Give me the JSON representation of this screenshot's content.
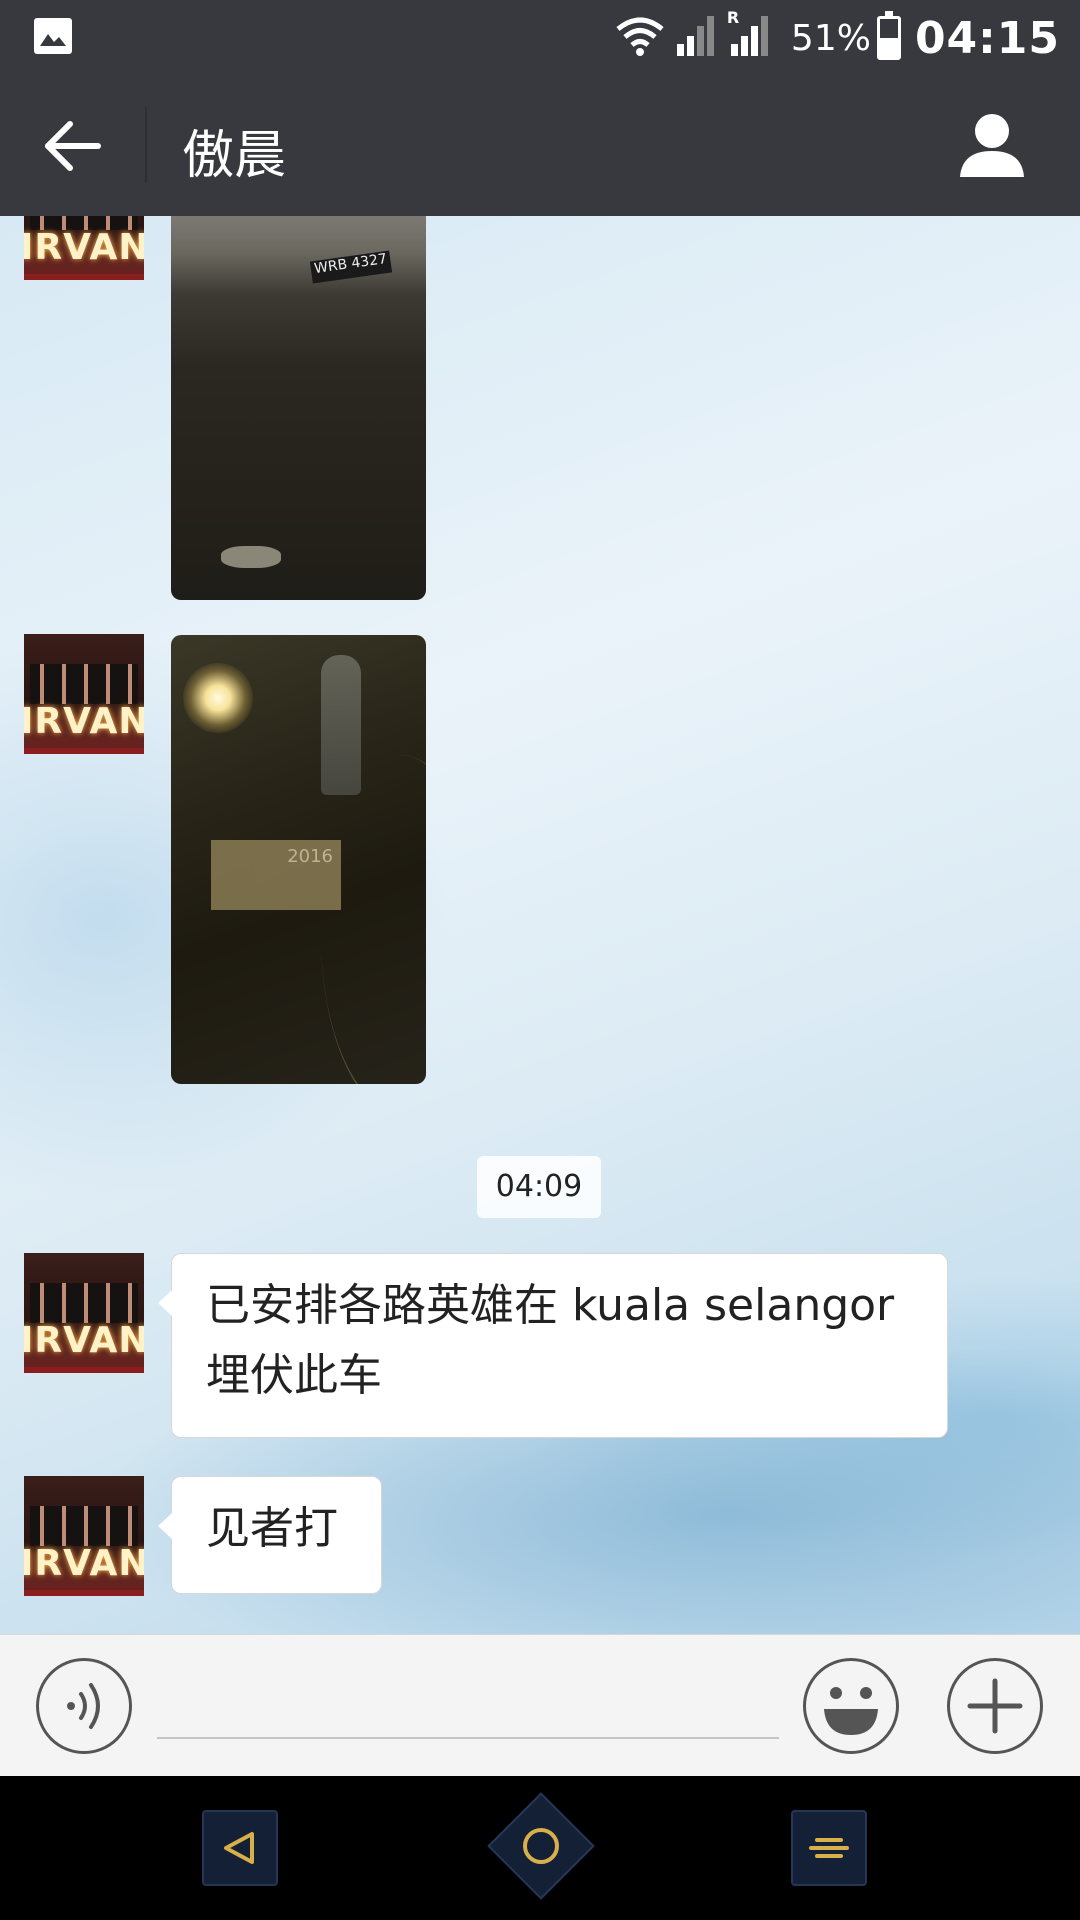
{
  "status_bar": {
    "battery_percent": "51%",
    "battery_level": 0.51,
    "time": "04:15",
    "roaming_indicator": "R",
    "icons": [
      "gallery-icon",
      "wifi-icon",
      "signal-icon",
      "signal-roaming-icon",
      "battery-icon"
    ]
  },
  "header": {
    "title": "傲晨",
    "back_icon": "arrow-left-icon",
    "profile_icon": "person-icon"
  },
  "chat": {
    "avatar_caption": "IRVANA",
    "photo_plate_text": "WRB 4327",
    "photo_sticker_text": "2016",
    "timestamp": "04:09",
    "messages": [
      {
        "type": "text",
        "text": "已安排各路英雄在 kuala selangor 埋伏此车"
      },
      {
        "type": "text",
        "text": "见者打"
      }
    ]
  },
  "input_bar": {
    "value": "",
    "placeholder": "",
    "voice_icon": "voice-icon",
    "emoji_icon": "emoji-icon",
    "plus_icon": "plus-icon"
  },
  "nav_bar": {
    "icons": [
      "nav-back-icon",
      "nav-home-icon",
      "nav-menu-icon"
    ]
  },
  "colors": {
    "header_bg": "#37393e",
    "input_bar_bg": "#f4f4f4",
    "bubble_bg": "#ffffff",
    "nav_button_bg": "#142036",
    "nav_icon_accent": "#d8b04a"
  }
}
